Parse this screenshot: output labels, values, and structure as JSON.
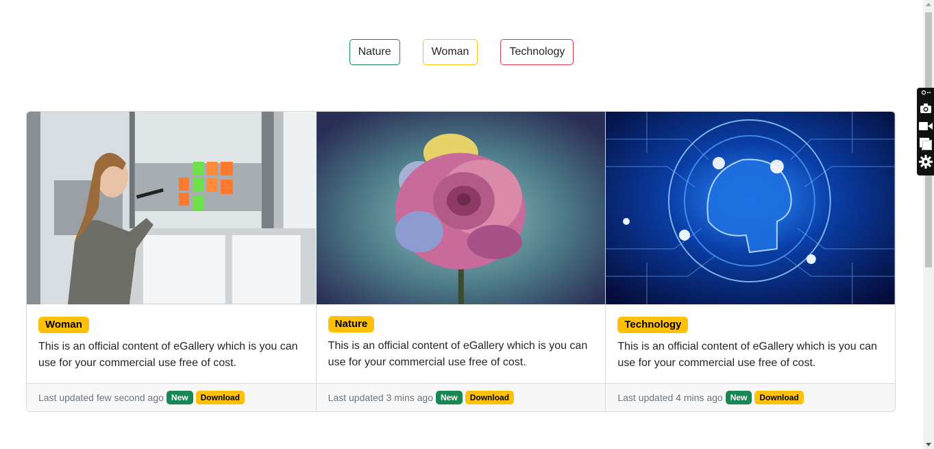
{
  "filters": [
    {
      "label": "Nature",
      "color": "#198754"
    },
    {
      "label": "Woman",
      "color": "#ffc107"
    },
    {
      "label": "Technology",
      "color": "#dc3545"
    }
  ],
  "cards": [
    {
      "image": "woman-at-window-photo",
      "category": "Woman",
      "text": "This is an official content of eGallery which is you can use for your commercial use free of cost.",
      "updated": "Last updated few second ago",
      "new_label": "New",
      "download_label": "Download"
    },
    {
      "image": "rose-flower-photo",
      "category": "Nature",
      "text": "This is an official content of eGallery which is you can use for your commercial use free of cost.",
      "updated": "Last updated 3 mins ago",
      "new_label": "New",
      "download_label": "Download"
    },
    {
      "image": "circuit-brain-photo",
      "category": "Technology",
      "text": "This is an official content of eGallery which is you can use for your commercial use free of cost.",
      "updated": "Last updated 4 mins ago",
      "new_label": "New",
      "download_label": "Download"
    }
  ],
  "toolbar": {
    "icons": [
      "link-icon",
      "camera-icon",
      "video-icon",
      "gallery-icon",
      "gear-icon"
    ],
    "top_glyph": "⋯"
  },
  "colors": {
    "success": "#198754",
    "warning": "#ffc107",
    "danger": "#dc3545"
  }
}
